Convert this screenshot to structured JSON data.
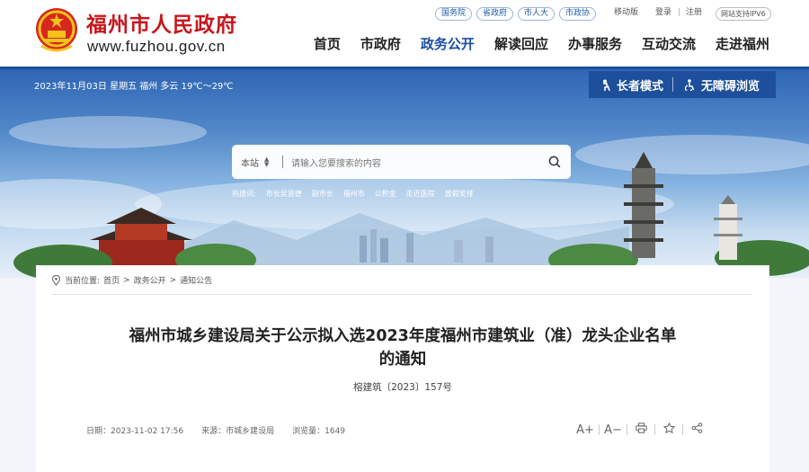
{
  "header": {
    "site_name": "福州市人民政府",
    "site_url": "www.fuzhou.gov.cn",
    "top_links": [
      "国务院",
      "省政府",
      "市人大",
      "市政协"
    ],
    "mobile": "移动版",
    "login": "登录",
    "separator": "|",
    "register": "注册",
    "ipv6": "网站支持IPV6",
    "nav": [
      "首页",
      "市政府",
      "政务公开",
      "解读回应",
      "办事服务",
      "互动交流",
      "走进福州"
    ],
    "active_nav": "政务公开",
    "brand_color": "#c8161d",
    "accent_color": "#1a4fa0"
  },
  "banner": {
    "date_weather": "2023年11月03日 星期五   福州 多云 19℃～29℃",
    "elder_mode": "长者模式",
    "accessible": "无障碍浏览",
    "search_scope": "本站",
    "search_placeholder": "请输入您要搜索的内容",
    "hot_words": [
      "热搜词:",
      "市长吴贤德",
      "副市长",
      "福州市",
      "公积金",
      "走近医院",
      "放假安排"
    ]
  },
  "breadcrumb": {
    "label": "当前位置:",
    "items": [
      "首页",
      "政务公开",
      "通知公告"
    ],
    "sep": ">"
  },
  "article": {
    "title_line1": "福州市城乡建设局关于公示拟入选2023年度福州市建筑业（准）龙头企业名单",
    "title_line2": "的通知",
    "doc_number": "榕建筑〔2023〕157号",
    "date": "日期：2023-11-02 17:56",
    "source": "来源：市城乡建设局",
    "views": "浏览量：1649"
  },
  "tools": {
    "font_larger": "A+",
    "font_smaller": "A−"
  }
}
